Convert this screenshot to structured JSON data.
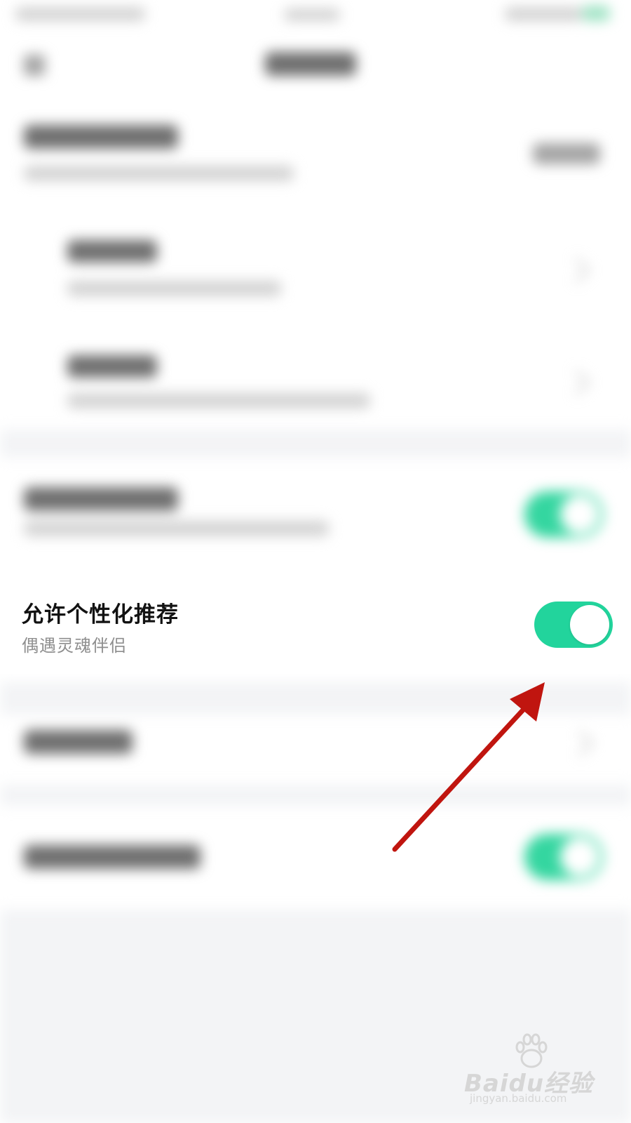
{
  "settings_row": {
    "title": "允许个性化推荐",
    "subtitle": "偶遇灵魂伴侣",
    "toggle_state": "on",
    "toggle_color": "#22d49c"
  },
  "annotation": {
    "arrow_color": "#c0150f",
    "icon": "arrow-pointer-icon"
  },
  "watermark": {
    "logo_text": "Baidu经验",
    "url": "jingyan.baidu.com",
    "icon": "paw-icon"
  },
  "colors": {
    "accent": "#22d49c",
    "background": "#ffffff",
    "section_gap": "#f3f4f6"
  }
}
